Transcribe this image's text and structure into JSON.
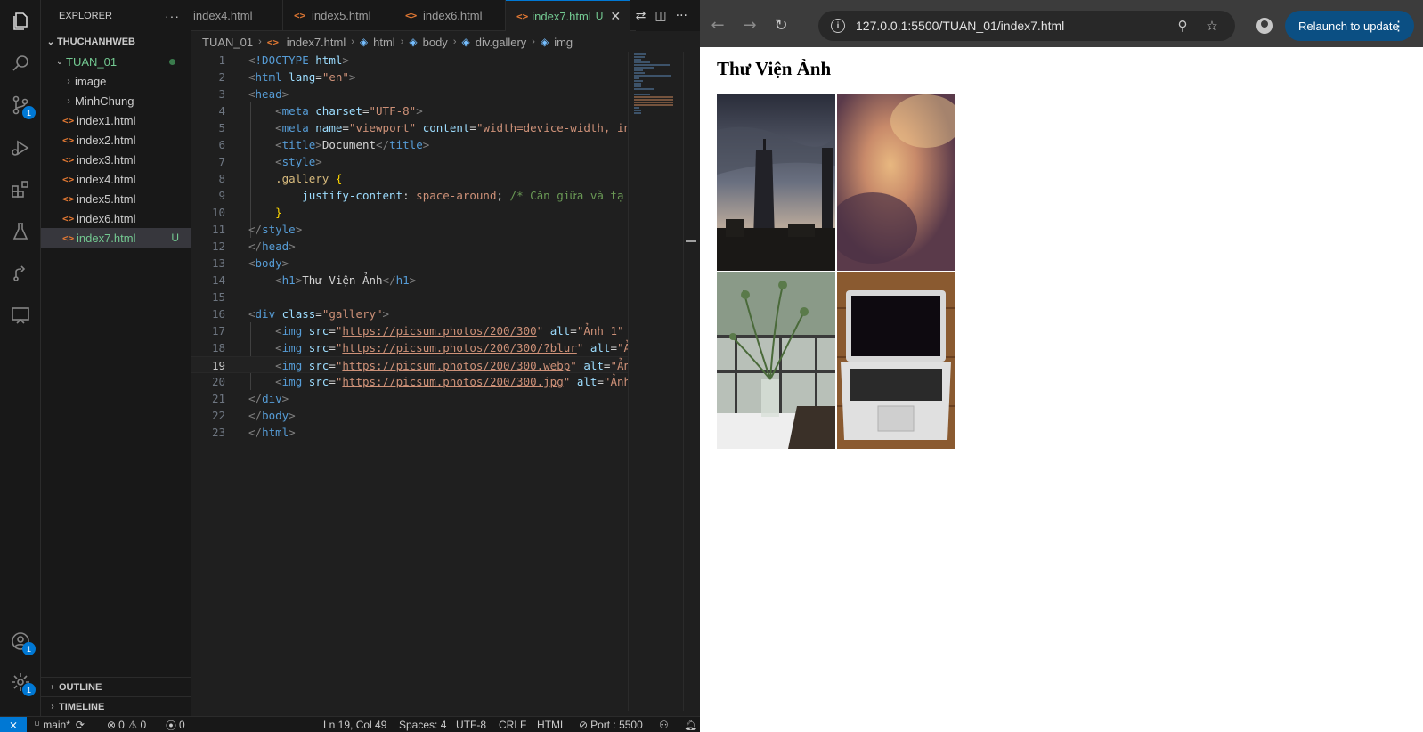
{
  "explorer": {
    "title": "EXPLORER",
    "more": "···",
    "workspace": "THUCHANHWEB",
    "folder": "TUAN_01",
    "subfolders": [
      "image",
      "MinhChung"
    ],
    "files": [
      "index1.html",
      "index2.html",
      "index3.html",
      "index4.html",
      "index5.html",
      "index6.html",
      "index7.html"
    ],
    "untracked_badge": "U",
    "outline": "OUTLINE",
    "timeline": "TIMELINE"
  },
  "activity_badges": {
    "source_control": "1",
    "accounts": "1",
    "settings": "1"
  },
  "tabs": [
    {
      "label": "index4.html"
    },
    {
      "label": "index5.html"
    },
    {
      "label": "index6.html"
    },
    {
      "label": "index7.html",
      "badge": "U"
    }
  ],
  "breadcrumb": [
    "TUAN_01",
    "index7.html",
    "html",
    "body",
    "div.gallery",
    "img"
  ],
  "code": {
    "line_numbers": [
      "1",
      "2",
      "3",
      "4",
      "5",
      "6",
      "7",
      "8",
      "9",
      "10",
      "11",
      "12",
      "13",
      "14",
      "15",
      "16",
      "17",
      "18",
      "19",
      "20",
      "21",
      "22",
      "23"
    ],
    "comment": "/* Căn giữa và tạ",
    "title_text": "Document",
    "h1_text": "Thư Viện Ảnh",
    "urls": [
      "https://picsum.photos/200/300",
      "https://picsum.photos/200/300/?blur",
      "https://picsum.photos/200/300.webp",
      "https://picsum.photos/200/300.jpg"
    ]
  },
  "status": {
    "branch": "main*",
    "errors": "0",
    "warnings": "0",
    "ports": "0",
    "position": "Ln 19, Col 49",
    "spaces": "Spaces: 4",
    "encoding": "UTF-8",
    "eol": "CRLF",
    "language": "HTML",
    "port": "Port : 5500"
  },
  "browser": {
    "url": "127.0.0.1:5500/TUAN_01/index7.html",
    "relaunch_label": "Relaunch to update",
    "page_heading": "Thư Viện Ảnh"
  }
}
